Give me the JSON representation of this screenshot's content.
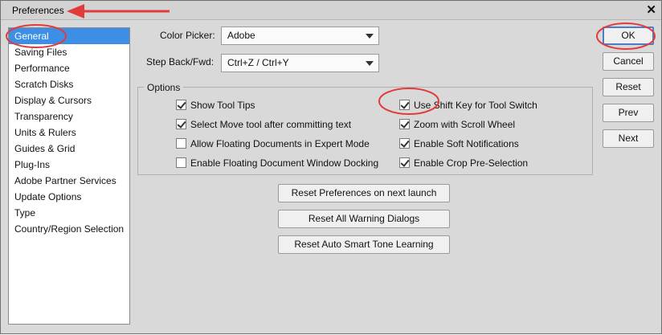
{
  "window": {
    "title": "Preferences",
    "close_glyph": "✕"
  },
  "sidebar": {
    "items": [
      {
        "label": "General",
        "selected": true
      },
      {
        "label": "Saving Files"
      },
      {
        "label": "Performance"
      },
      {
        "label": "Scratch Disks"
      },
      {
        "label": "Display & Cursors"
      },
      {
        "label": "Transparency"
      },
      {
        "label": "Units & Rulers"
      },
      {
        "label": "Guides & Grid"
      },
      {
        "label": "Plug-Ins"
      },
      {
        "label": "Adobe Partner Services"
      },
      {
        "label": "Update Options"
      },
      {
        "label": "Type"
      },
      {
        "label": "Country/Region Selection"
      }
    ]
  },
  "fields": {
    "color_picker": {
      "label": "Color Picker:",
      "value": "Adobe"
    },
    "step_back": {
      "label": "Step Back/Fwd:",
      "value": "Ctrl+Z / Ctrl+Y"
    }
  },
  "options": {
    "title": "Options",
    "left": [
      {
        "label": "Show Tool Tips",
        "checked": true
      },
      {
        "label": "Select Move tool after committing text",
        "checked": true
      },
      {
        "label": "Allow Floating Documents in Expert Mode",
        "checked": false
      },
      {
        "label": "Enable Floating Document Window Docking",
        "checked": false
      }
    ],
    "right": [
      {
        "label": "Use Shift Key for Tool Switch",
        "checked": true
      },
      {
        "label": "Zoom with Scroll Wheel",
        "checked": true
      },
      {
        "label": "Enable Soft Notifications",
        "checked": true
      },
      {
        "label": "Enable Crop Pre-Selection",
        "checked": true
      }
    ]
  },
  "reset_buttons": {
    "prefs": "Reset Preferences on next launch",
    "warnings": "Reset All Warning Dialogs",
    "smart_tone": "Reset Auto Smart Tone Learning"
  },
  "side_buttons": {
    "ok": "OK",
    "cancel": "Cancel",
    "reset": "Reset",
    "prev": "Prev",
    "next": "Next"
  },
  "colors": {
    "selection": "#3d8fe6",
    "annotation": "#e23b3b",
    "dialog_bg": "#d9d9d9"
  }
}
